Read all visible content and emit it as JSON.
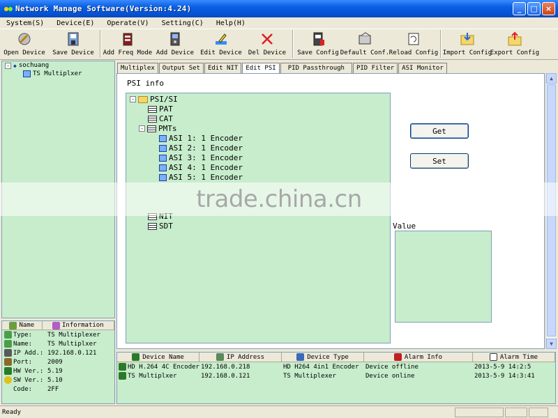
{
  "window": {
    "title": "Network Manage Software(Version:4.24)",
    "icon": "app-icon",
    "buttons": [
      "_",
      "□",
      "×"
    ]
  },
  "menu": [
    "System(S)",
    "Device(E)",
    "Operate(V)",
    "Setting(C)",
    "Help(H)"
  ],
  "toolbar": [
    {
      "label": "Open Device",
      "icon": "open-device-icon"
    },
    {
      "label": "Save Device",
      "icon": "save-device-icon"
    },
    {
      "label": "Add Freq Mode",
      "icon": "add-freq-mode-icon"
    },
    {
      "label": "Add Device",
      "icon": "add-device-icon"
    },
    {
      "label": "Edit Device",
      "icon": "edit-device-icon"
    },
    {
      "label": "Del Device",
      "icon": "del-device-icon"
    },
    {
      "label": "Save Config",
      "icon": "save-config-icon"
    },
    {
      "label": "Default Conf.",
      "icon": "default-conf-icon"
    },
    {
      "label": "Reload Config",
      "icon": "reload-config-icon"
    },
    {
      "label": "Import Config",
      "icon": "import-config-icon"
    },
    {
      "label": "Export Config",
      "icon": "export-config-icon"
    }
  ],
  "device_tree": {
    "root": "sochuang",
    "child": "TS Multiplxer"
  },
  "info": {
    "headers": [
      "Name",
      "Information"
    ],
    "rows": [
      {
        "key": "Type:",
        "value": "TS Multiplexer"
      },
      {
        "key": "Name:",
        "value": "TS Multiplxer"
      },
      {
        "key": "IP Add.:",
        "value": "192.168.0.121"
      },
      {
        "key": "Port:",
        "value": "2009"
      },
      {
        "key": "HW Ver.:",
        "value": "5.19"
      },
      {
        "key": "SW Ver.:",
        "value": "5.10"
      },
      {
        "key": "Code:",
        "value": "2FF"
      }
    ]
  },
  "tabs": [
    "Multiplex",
    "Output Set",
    "Edit NIT",
    "Edit PSI",
    "PID Passthrough",
    "PID Filter",
    "ASI Monitor"
  ],
  "active_tab": "Edit PSI",
  "psi": {
    "title": "PSI info",
    "root": "PSI/SI",
    "nodes": {
      "pat": "PAT",
      "cat": "CAT",
      "pmts": "PMTs",
      "pmt_items": [
        "ASI 1: 1 Encoder",
        "ASI 2: 1 Encoder",
        "ASI 3: 1 Encoder",
        "ASI 4: 1 Encoder",
        "ASI 5: 1 Encoder"
      ],
      "nit": "NIT",
      "sdt": "SDT"
    },
    "get_label": "Get",
    "set_label": "Set",
    "value_label": "Value"
  },
  "alarms": {
    "headers": [
      "Device Name",
      "IP Address",
      "Device Type",
      "Alarm Info",
      "Alarm Time"
    ],
    "rows": [
      [
        "HD H.264 4C Encoder",
        "192.168.0.218",
        "HD H264 4in1 Encoder",
        "Device offline",
        "2013-5-9 14:2:5"
      ],
      [
        "TS Multiplxer",
        "192.168.0.121",
        "TS Multiplexer",
        "Device online",
        "2013-5-9 14:3:41"
      ]
    ]
  },
  "status": "Ready",
  "watermark": "trade.china.cn"
}
